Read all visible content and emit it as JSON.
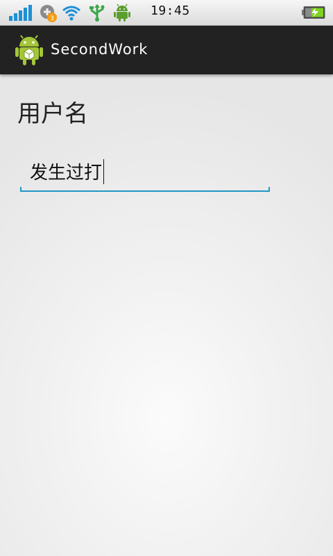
{
  "colors": {
    "accent": "#33b5e5",
    "field_underline": "#2196c4",
    "action_bar_bg": "#222222",
    "android_green": "#a4c639",
    "battery_green": "#7ed321",
    "notification_orange": "#f39c12"
  },
  "status_bar": {
    "time": "19:45",
    "icons": [
      "signal-icon",
      "sync-icon",
      "wifi-icon",
      "usb-icon",
      "android-debug-icon",
      "battery-charging-icon"
    ],
    "notification_badge": "3"
  },
  "action_bar": {
    "app_icon": "android-app-icon",
    "title": "SecondWork"
  },
  "form": {
    "username_label": "用户名",
    "username_value": "发生过打"
  }
}
